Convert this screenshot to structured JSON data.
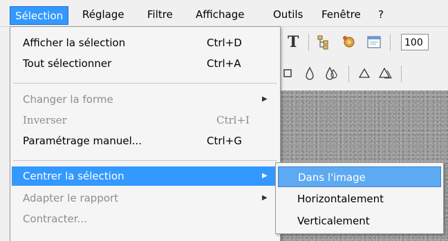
{
  "menubar": {
    "items": [
      {
        "label": "Sélection",
        "active": true
      },
      {
        "label": "Réglage"
      },
      {
        "label": "Filtre"
      },
      {
        "label": "Affichage"
      },
      {
        "label": "Outils"
      },
      {
        "label": "Fenêtre"
      },
      {
        "label": "?"
      }
    ]
  },
  "toolbar": {
    "text_tool_glyph": "T",
    "zoom_value": "100"
  },
  "selection_menu": {
    "items": [
      {
        "label": "Afficher la sélection",
        "shortcut": "Ctrl+D"
      },
      {
        "label": "Tout sélectionner",
        "shortcut": "Ctrl+A"
      },
      {
        "label": "Changer la forme",
        "disabled": true,
        "submenu_arrow": "▶"
      },
      {
        "label": "Inverser",
        "shortcut": "Ctrl+I",
        "disabled": true
      },
      {
        "label": "Paramétrage manuel...",
        "shortcut": "Ctrl+G"
      },
      {
        "label": "Centrer la sélection",
        "highlighted": true,
        "submenu_arrow": "▶"
      },
      {
        "label": "Adapter le rapport",
        "disabled": true,
        "submenu_arrow": "▶"
      },
      {
        "label": "Contracter...",
        "disabled": true
      }
    ]
  },
  "center_submenu": {
    "items": [
      {
        "label": "Dans l'image",
        "highlighted": true
      },
      {
        "label": "Horizontalement"
      },
      {
        "label": "Verticalement"
      }
    ]
  },
  "colors": {
    "highlight": "#3399ff",
    "submenu_highlight": "#5eaaf2",
    "disabled_text": "#8d8d8d",
    "menu_background": "#f5f5f5"
  }
}
